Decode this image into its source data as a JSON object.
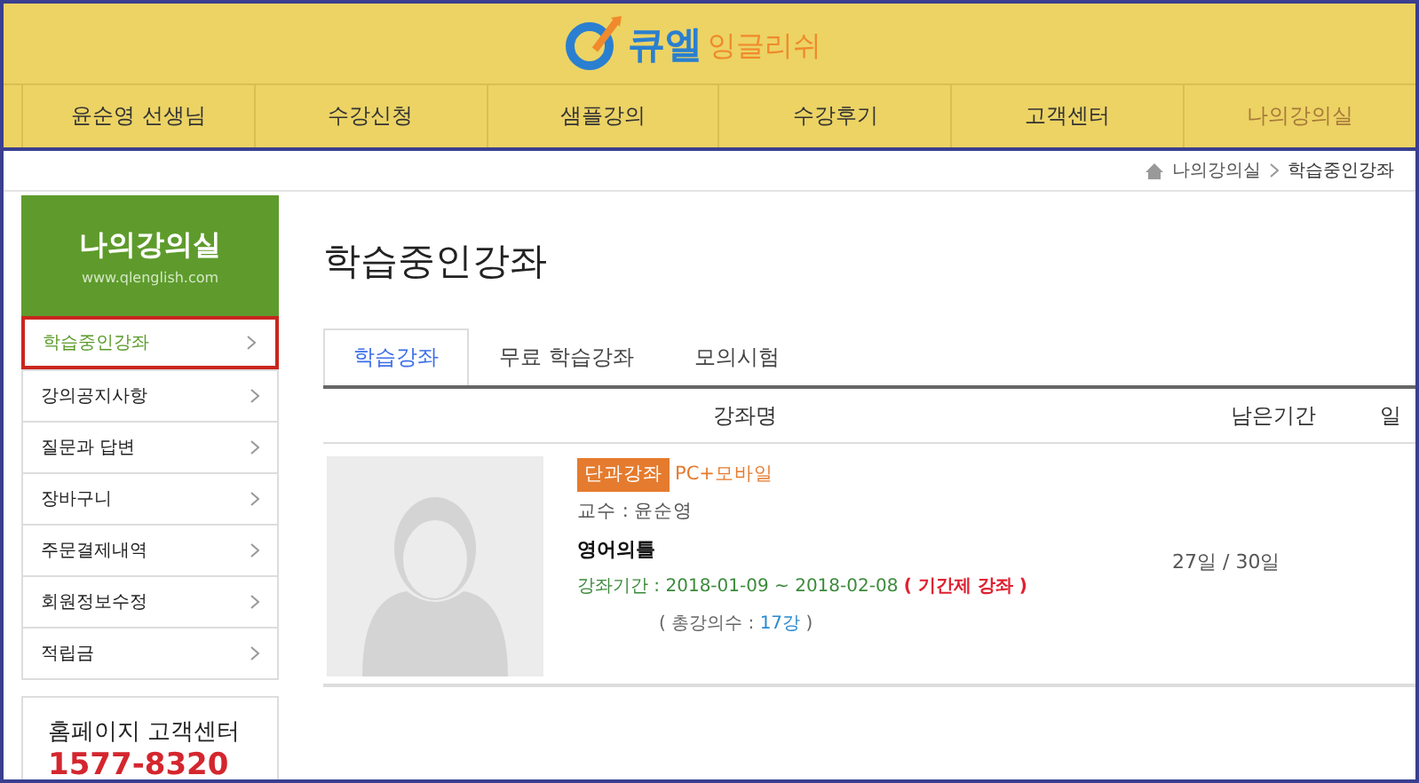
{
  "header": {
    "logo_main": "큐엘",
    "logo_sub": "잉글리쉬"
  },
  "nav": [
    {
      "label": "윤순영 선생님",
      "selected": false
    },
    {
      "label": "수강신청",
      "selected": false
    },
    {
      "label": "샘플강의",
      "selected": false
    },
    {
      "label": "수강후기",
      "selected": false
    },
    {
      "label": "고객센터",
      "selected": false
    },
    {
      "label": "나의강의실",
      "selected": true
    }
  ],
  "breadcrumb": [
    "나의강의실",
    "학습중인강좌"
  ],
  "sidebar": {
    "title": "나의강의실",
    "url": "www.qlenglish.com",
    "items": [
      {
        "label": "학습중인강좌",
        "selected": true
      },
      {
        "label": "강의공지사항",
        "selected": false
      },
      {
        "label": "질문과 답변",
        "selected": false
      },
      {
        "label": "장바구니",
        "selected": false
      },
      {
        "label": "주문결제내역",
        "selected": false
      },
      {
        "label": "회원정보수정",
        "selected": false
      },
      {
        "label": "적립금",
        "selected": false
      }
    ],
    "support": {
      "title": "홈페이지 고객센터",
      "phone": "1577-8320"
    }
  },
  "page_title": "학습중인강좌",
  "tabs": [
    {
      "label": "학습강좌",
      "selected": true
    },
    {
      "label": "무료 학습강좌",
      "selected": false
    },
    {
      "label": "모의시험",
      "selected": false
    }
  ],
  "table": {
    "columns": [
      "강좌명",
      "남은기간",
      "일"
    ],
    "rows": [
      {
        "badge": "단과강좌",
        "platform": "PC+모바일",
        "teacher": "교수 : 윤순영",
        "course": "영어의틀",
        "period": "강좌기간 : 2018-01-09 ~ 2018-02-08",
        "period_type": "( 기간제 강좌 )",
        "total_prefix": "( 총강의수 : ",
        "total_count": "17강",
        "total_suffix": " )",
        "remaining": "27일 / 30일"
      }
    ]
  }
}
